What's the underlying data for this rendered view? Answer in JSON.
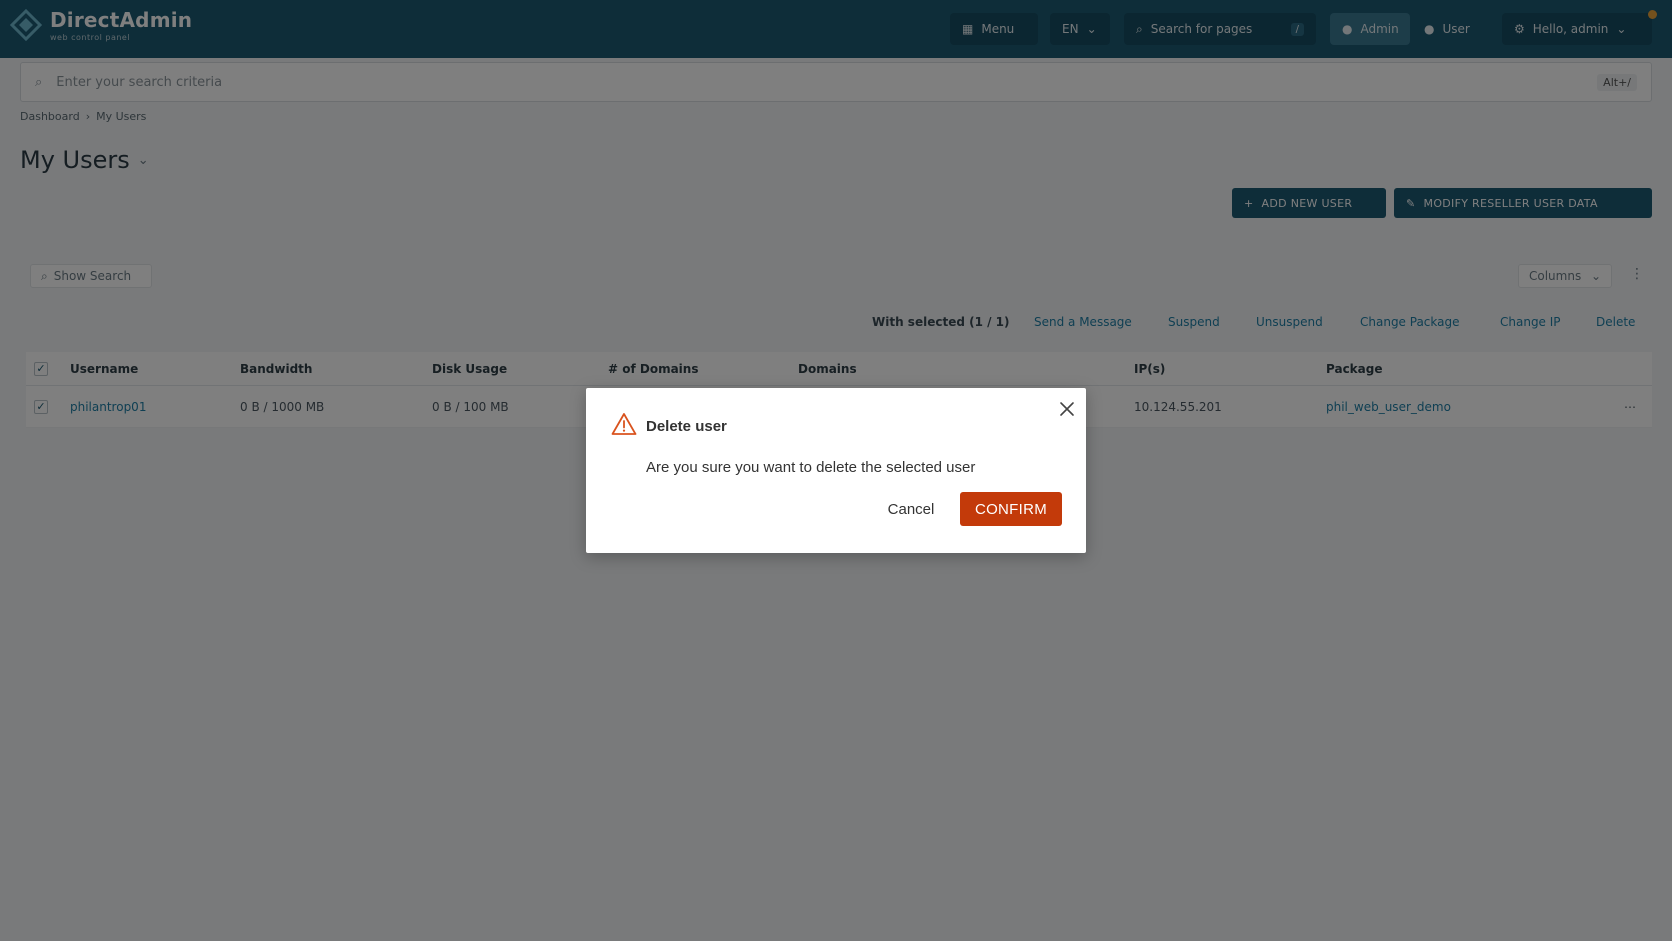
{
  "header": {
    "logo_title": "DirectAdmin",
    "logo_subtitle": "web control panel",
    "menu_label": "Menu",
    "language": "EN",
    "search_placeholder": "Search for pages",
    "search_shortcut": "/",
    "admin_label": "Admin",
    "user_label": "User",
    "account_label": "Hello, admin"
  },
  "top_search": {
    "placeholder": "Enter your search criteria",
    "shortcut": "Alt+/"
  },
  "breadcrumb": [
    "Dashboard",
    "My Users"
  ],
  "page": {
    "title": "My Users"
  },
  "actions": {
    "add_user": "ADD NEW USER",
    "modify_users": "MODIFY RESELLER USER DATA"
  },
  "table_controls": {
    "show_search": "Show Search",
    "columns": "Columns"
  },
  "bulk": {
    "label": "With selected (1 / 1)",
    "links": [
      "Send a Message",
      "Suspend",
      "Unsuspend",
      "Change Package",
      "Change IP",
      "Delete"
    ]
  },
  "table": {
    "columns": [
      "Username",
      "Bandwidth",
      "Disk Usage",
      "# of Domains",
      "Domains",
      "IP(s)",
      "Package"
    ],
    "rows": [
      [
        "philantrop01",
        "0 B / 1000 MB",
        "0 B / 100 MB",
        "",
        "",
        "10.124.55.201",
        "phil_web_user_demo"
      ]
    ]
  },
  "modal": {
    "title": "Delete user",
    "message": "Are you sure you want to delete the selected user",
    "cancel": "Cancel",
    "confirm": "CONFIRM"
  },
  "colors": {
    "header": "#1c5a73",
    "confirm": "#c33a0a",
    "warning": "#d9531e"
  }
}
